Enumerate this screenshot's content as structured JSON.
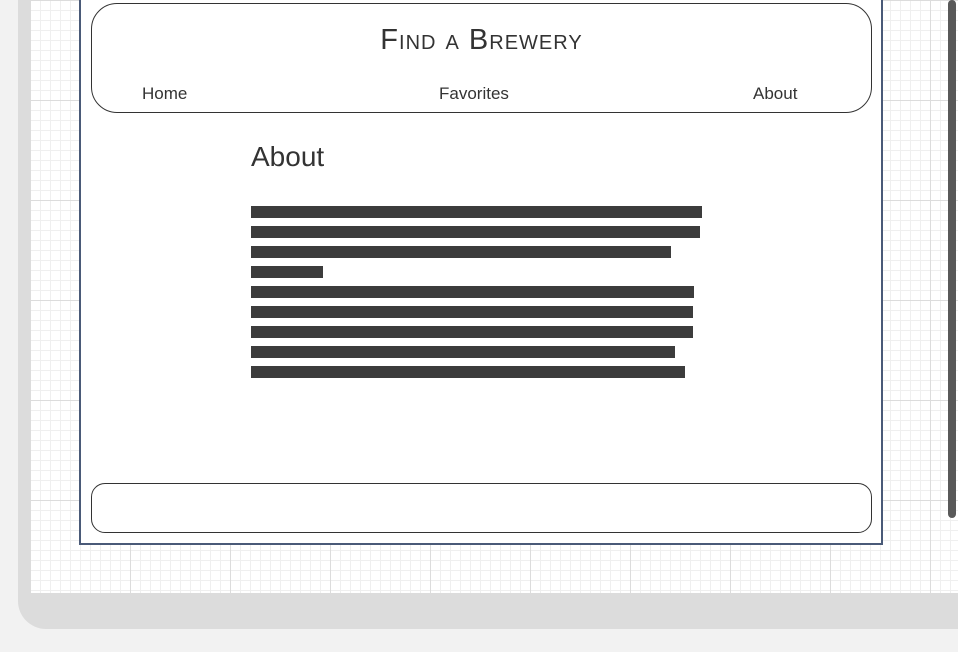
{
  "site": {
    "title": "Find a Brewery"
  },
  "nav": {
    "items": [
      {
        "label": "Home"
      },
      {
        "label": "Favorites"
      },
      {
        "label": "About"
      }
    ]
  },
  "main": {
    "heading": "About",
    "placeholder_lines": 9
  },
  "colors": {
    "frame_border": "#4a5a78",
    "text": "#333333",
    "text_bar": "#3c3c3c",
    "canvas_grid": "#dcdcdc"
  }
}
